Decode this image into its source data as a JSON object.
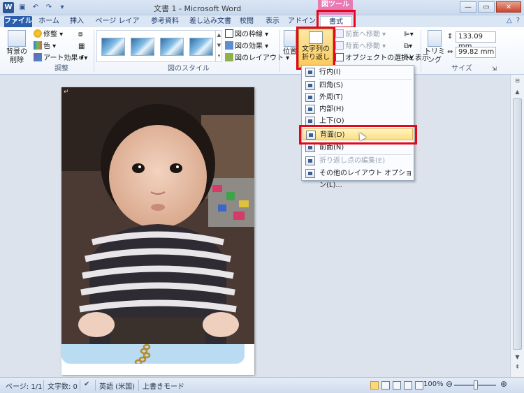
{
  "window": {
    "title": "文書 1 - Microsoft Word",
    "app_icon_letter": "W",
    "contextual_group": "図ツール",
    "controls": {
      "minimize": "—",
      "restore": "▭",
      "close": "✕"
    }
  },
  "quick_access": [
    "save-icon",
    "undo-icon",
    "redo-icon",
    "customize-icon"
  ],
  "tabs": [
    {
      "label": "ファイル"
    },
    {
      "label": "ホーム"
    },
    {
      "label": "挿入"
    },
    {
      "label": "ページ レイアウト"
    },
    {
      "label": "参考資料"
    },
    {
      "label": "差し込み文書"
    },
    {
      "label": "校閲"
    },
    {
      "label": "表示"
    },
    {
      "label": "アドイン"
    },
    {
      "label": "書式"
    }
  ],
  "ribbon": {
    "remove_bg": {
      "label_line1": "背景の",
      "label_line2": "削除"
    },
    "adjust": {
      "group": "調整",
      "correct": "修整",
      "color": "色",
      "artistic": "アート効果"
    },
    "picture_styles": {
      "group": "図のスタイル",
      "border": "図の枠線",
      "effects": "図の効果",
      "layout": "図のレイアウト"
    },
    "arrange": {
      "position": "位置",
      "wrap_line1": "文字列の",
      "wrap_line2": "折り返し",
      "bring_forward": "前面へ移動",
      "send_backward": "背面へ移動",
      "selection_pane": "オブジェクトの選択と表示"
    },
    "size": {
      "group": "サイズ",
      "crop": "トリミング",
      "height": "133.09 mm",
      "width": "99.82 mm"
    }
  },
  "wrap_menu": {
    "items": [
      {
        "label": "行内(I)"
      },
      {
        "label": "四角(S)"
      },
      {
        "label": "外周(T)"
      },
      {
        "label": "内部(H)"
      },
      {
        "label": "上下(O)"
      },
      {
        "label": "背面(D)"
      },
      {
        "label": "前面(N)"
      },
      {
        "label": "折り返し点の編集(E)"
      },
      {
        "label": "その他のレイアウト オプション(L)..."
      }
    ]
  },
  "statusbar": {
    "page": "ページ: 1/1",
    "word_count": "文字数: 0",
    "language": "英語 (米国)",
    "mode": "上書きモード",
    "zoom": "100%"
  }
}
